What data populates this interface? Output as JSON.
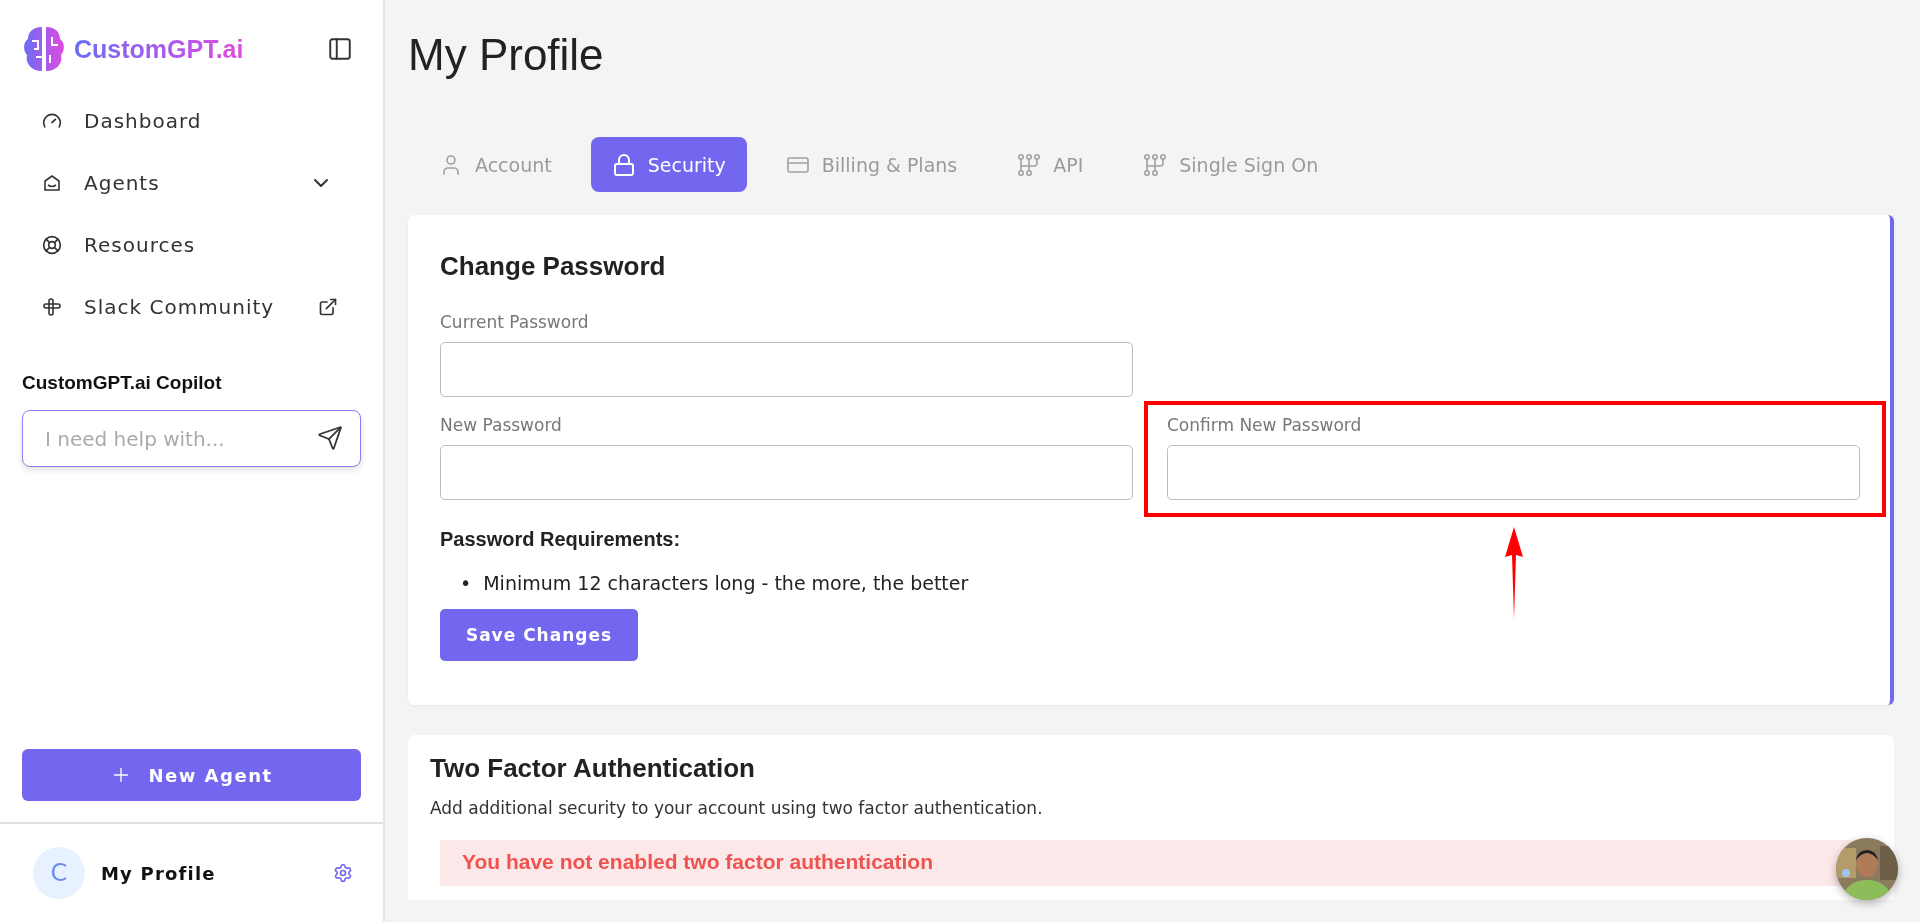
{
  "sidebar": {
    "logo_text": "CustomGPT.ai",
    "nav_items": [
      {
        "label": "Dashboard",
        "kind": "link"
      },
      {
        "label": "Agents",
        "kind": "expandable",
        "expanded": false
      },
      {
        "label": "Resources",
        "kind": "link"
      },
      {
        "label": "Slack Community",
        "kind": "external"
      }
    ],
    "copilot": {
      "title": "CustomGPT.ai Copilot",
      "placeholder": "I need help with..."
    },
    "new_agent_button": "New Agent",
    "profile": {
      "initial": "C",
      "name": "My Profile"
    }
  },
  "page": {
    "title": "My Profile"
  },
  "tabs": [
    {
      "label": "Account",
      "selected": false
    },
    {
      "label": "Security",
      "selected": true
    },
    {
      "label": "Billing & Plans",
      "selected": false
    },
    {
      "label": "API",
      "selected": false
    },
    {
      "label": "Single Sign On",
      "selected": false
    }
  ],
  "change_password": {
    "title": "Change Password",
    "fields": [
      {
        "label": "Current Password"
      },
      {
        "label": "New Password"
      },
      {
        "label": "Confirm New Password"
      }
    ],
    "requirements_title": "Password Requirements:",
    "requirements": [
      {
        "marker": "•",
        "text": "Minimum 12 characters long - the more, the better"
      }
    ],
    "save_button": "Save Changes"
  },
  "two_factor": {
    "title": "Two Factor Authentication",
    "description": "Add additional security to your account using two factor authentication.",
    "alert": "You have not enabled two factor authentication"
  },
  "annotation": {
    "frame": true,
    "arrow": true
  }
}
